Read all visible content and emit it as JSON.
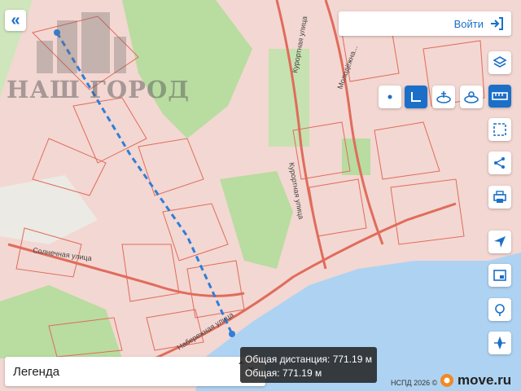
{
  "map": {
    "street_labels": [
      {
        "name": "solnechnaya",
        "text": "Солнечная улица"
      },
      {
        "name": "naberezhnaya",
        "text": "Набережная улица"
      },
      {
        "name": "kurortnaya-top",
        "text": "Курортная улица"
      },
      {
        "name": "kurortnaya-mid",
        "text": "Курортная улица"
      },
      {
        "name": "partial-street",
        "text": "Молодёжна..."
      }
    ],
    "colors": {
      "land": "#f3d7d2",
      "parcel_line": "#e06c5c",
      "green": "#b9dca0",
      "water": "#aed3f2",
      "route": "#2f7ed8"
    }
  },
  "watermark": {
    "text": "НАШ ГОРОД"
  },
  "top_left": {
    "collapse_icon": "double-chevron-left-icon",
    "collapse_glyph": "«"
  },
  "login": {
    "label": "Войти",
    "icon": "login-arrow-icon"
  },
  "mode_buttons": [
    {
      "name": "point-mode",
      "icon": "dot-icon",
      "active": false
    },
    {
      "name": "distance-mode",
      "icon": "ruler-l-icon",
      "active": true
    },
    {
      "name": "area-mode",
      "icon": "area-icon",
      "active": false
    },
    {
      "name": "radius-mode",
      "icon": "radius-icon",
      "active": false
    }
  ],
  "toolbar": [
    {
      "name": "layers",
      "icon": "layers-icon",
      "active": false
    },
    {
      "name": "measure",
      "icon": "ruler-icon",
      "active": true
    },
    {
      "name": "select-area",
      "icon": "select-area-icon",
      "active": false
    },
    {
      "name": "share",
      "icon": "share-icon",
      "active": false
    },
    {
      "name": "print",
      "icon": "print-icon",
      "active": false
    },
    {
      "name": "locate",
      "icon": "location-arrow-icon",
      "active": false
    },
    {
      "name": "card",
      "icon": "card-icon",
      "active": false
    },
    {
      "name": "geo-search",
      "icon": "geo-search-icon",
      "active": false
    },
    {
      "name": "compass",
      "icon": "compass-icon",
      "active": false
    }
  ],
  "measure": {
    "total_label": "Общая дистанция: 771.19 м",
    "partial_label": "Общая: 771.19 м"
  },
  "legend": {
    "label": "Легенда",
    "arrows": "⌃⌄"
  },
  "footer": {
    "nspd": "НСПД 2026 ©",
    "logo_text": "move.ru"
  }
}
